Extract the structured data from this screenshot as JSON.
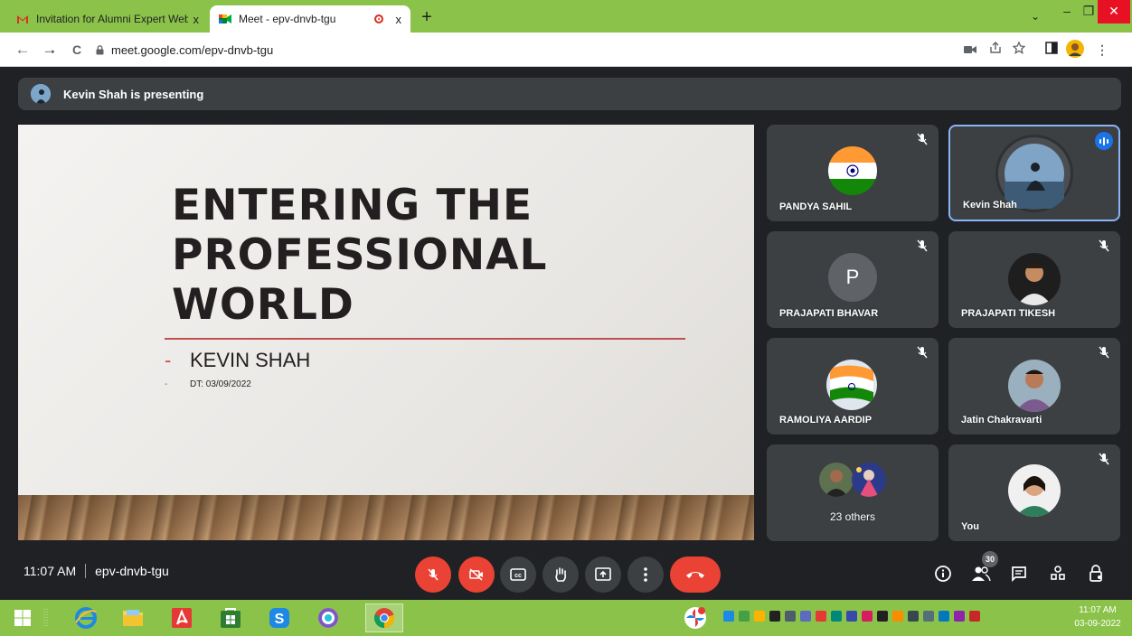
{
  "browser": {
    "tabs": [
      {
        "title": "Invitation for Alumni Expert Web",
        "close": "x"
      },
      {
        "title": "Meet - epv-dnvb-tgu",
        "close": "x"
      }
    ],
    "new_tab": "+",
    "window_controls": {
      "chevron": "⌄",
      "minimize": "–",
      "maximize": "❐",
      "close": "✕"
    },
    "url": "meet.google.com/epv-dnvb-tgu",
    "nav": {
      "back": "←",
      "forward": "→",
      "reload": "C"
    },
    "toolbar_icons": [
      "camera-icon",
      "share-icon",
      "star-icon",
      "sidepanel-icon",
      "profile-avatar",
      "menu-icon"
    ],
    "colors": {
      "chrome_frame": "#8bc34a",
      "close_button": "#e81123"
    }
  },
  "meet": {
    "presenting_banner": "Kevin Shah is presenting",
    "slide": {
      "title": "ENTERING THE\nPROFESSIONAL\nWORLD",
      "author_dash": "-",
      "author": "KEVIN SHAH",
      "date_dash": "-",
      "date": "DT: 03/09/2022"
    },
    "participants": [
      {
        "name": "PANDYA SAHIL",
        "muted": true
      },
      {
        "name": "Kevin Shah",
        "speaking": true
      },
      {
        "name": "PRAJAPATI BHAVAR",
        "initial": "P",
        "muted": true
      },
      {
        "name": "PRAJAPATI TIKESH",
        "muted": true
      },
      {
        "name": "RAMOLIYA AARDIP",
        "muted": true
      },
      {
        "name": "Jatin Chakravarti",
        "muted": true
      },
      {
        "name": "23 others"
      },
      {
        "name": "You",
        "muted": true
      }
    ],
    "time": "11:07 AM",
    "meeting_code": "epv-dnvb-tgu",
    "participant_count": "30",
    "colors": {
      "background": "#202124",
      "tile": "#3c4043",
      "danger": "#ea4335",
      "speaking": "#1a73e8"
    }
  },
  "taskbar": {
    "clock_time": "11:07 AM",
    "clock_date": "03-09-2022"
  }
}
